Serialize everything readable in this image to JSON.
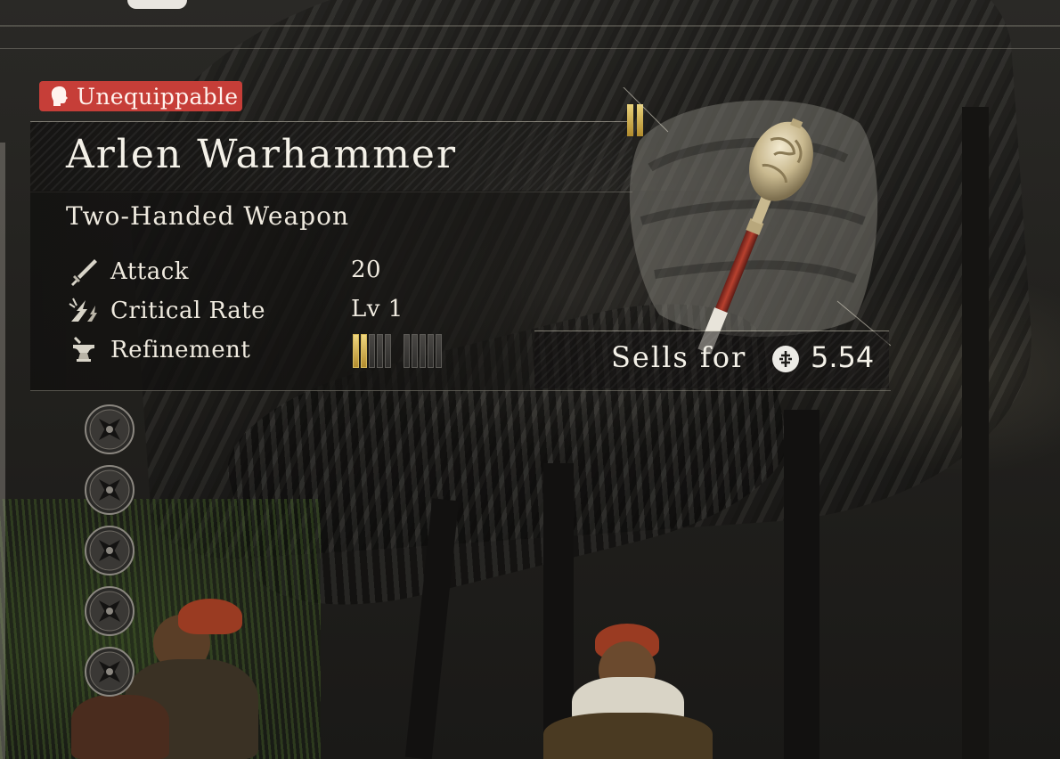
{
  "item": {
    "status_badge": "Unequippable",
    "name": "Arlen Warhammer",
    "category": "Two-Handed Weapon",
    "tier_marks": 2,
    "stats": [
      {
        "icon": "sword-icon",
        "label": "Attack",
        "value": "20"
      },
      {
        "icon": "critical-strike-icon",
        "label": "Critical Rate",
        "value": "Lv 1"
      },
      {
        "icon": "anvil-icon",
        "label": "Refinement",
        "value": ""
      }
    ],
    "refinement": {
      "filled": 2,
      "total": 10
    },
    "sell": {
      "label": "Sells for",
      "value": "5.54",
      "currency_icon": "coin-icon"
    }
  },
  "augment_slots": [
    {
      "icon": "empty-slot-icon"
    },
    {
      "icon": "empty-slot-icon"
    },
    {
      "icon": "empty-slot-icon"
    },
    {
      "icon": "empty-slot-icon"
    },
    {
      "icon": "empty-slot-icon"
    }
  ],
  "colors": {
    "badge": "#c63e38",
    "gold": "#d9bc5e",
    "text": "#f2efe6"
  }
}
